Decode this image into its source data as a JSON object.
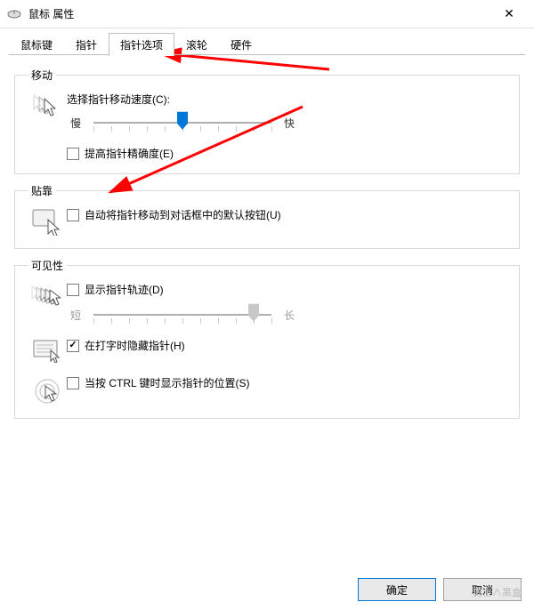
{
  "window": {
    "title": "鼠标 属性",
    "close_glyph": "✕"
  },
  "tabs": [
    {
      "label": "鼠标键",
      "active": false
    },
    {
      "label": "指针",
      "active": false
    },
    {
      "label": "指针选项",
      "active": true
    },
    {
      "label": "滚轮",
      "active": false
    },
    {
      "label": "硬件",
      "active": false
    }
  ],
  "groups": {
    "motion": {
      "title": "移动",
      "speed_label": "选择指针移动速度(C):",
      "slow": "慢",
      "fast": "快",
      "speed_value": 6,
      "speed_min": 1,
      "speed_max": 11,
      "enhance_label": "提高指针精确度(E)",
      "enhance_checked": false
    },
    "snap": {
      "title": "贴靠",
      "snap_label": "自动将指针移动到对话框中的默认按钮(U)",
      "snap_checked": false
    },
    "visibility": {
      "title": "可见性",
      "trails_label": "显示指针轨迹(D)",
      "trails_checked": false,
      "short": "短",
      "long": "长",
      "trails_value": 10,
      "trails_min": 1,
      "trails_max": 11,
      "hide_typing_label": "在打字时隐藏指针(H)",
      "hide_typing_checked": true,
      "ctrl_locate_label": "当按 CTRL 键时显示指针的位置(S)",
      "ctrl_locate_checked": false
    }
  },
  "footer": {
    "ok": "确定",
    "cancel": "取消"
  },
  "annotation": {
    "watermark": "勇士∧黑盒"
  }
}
